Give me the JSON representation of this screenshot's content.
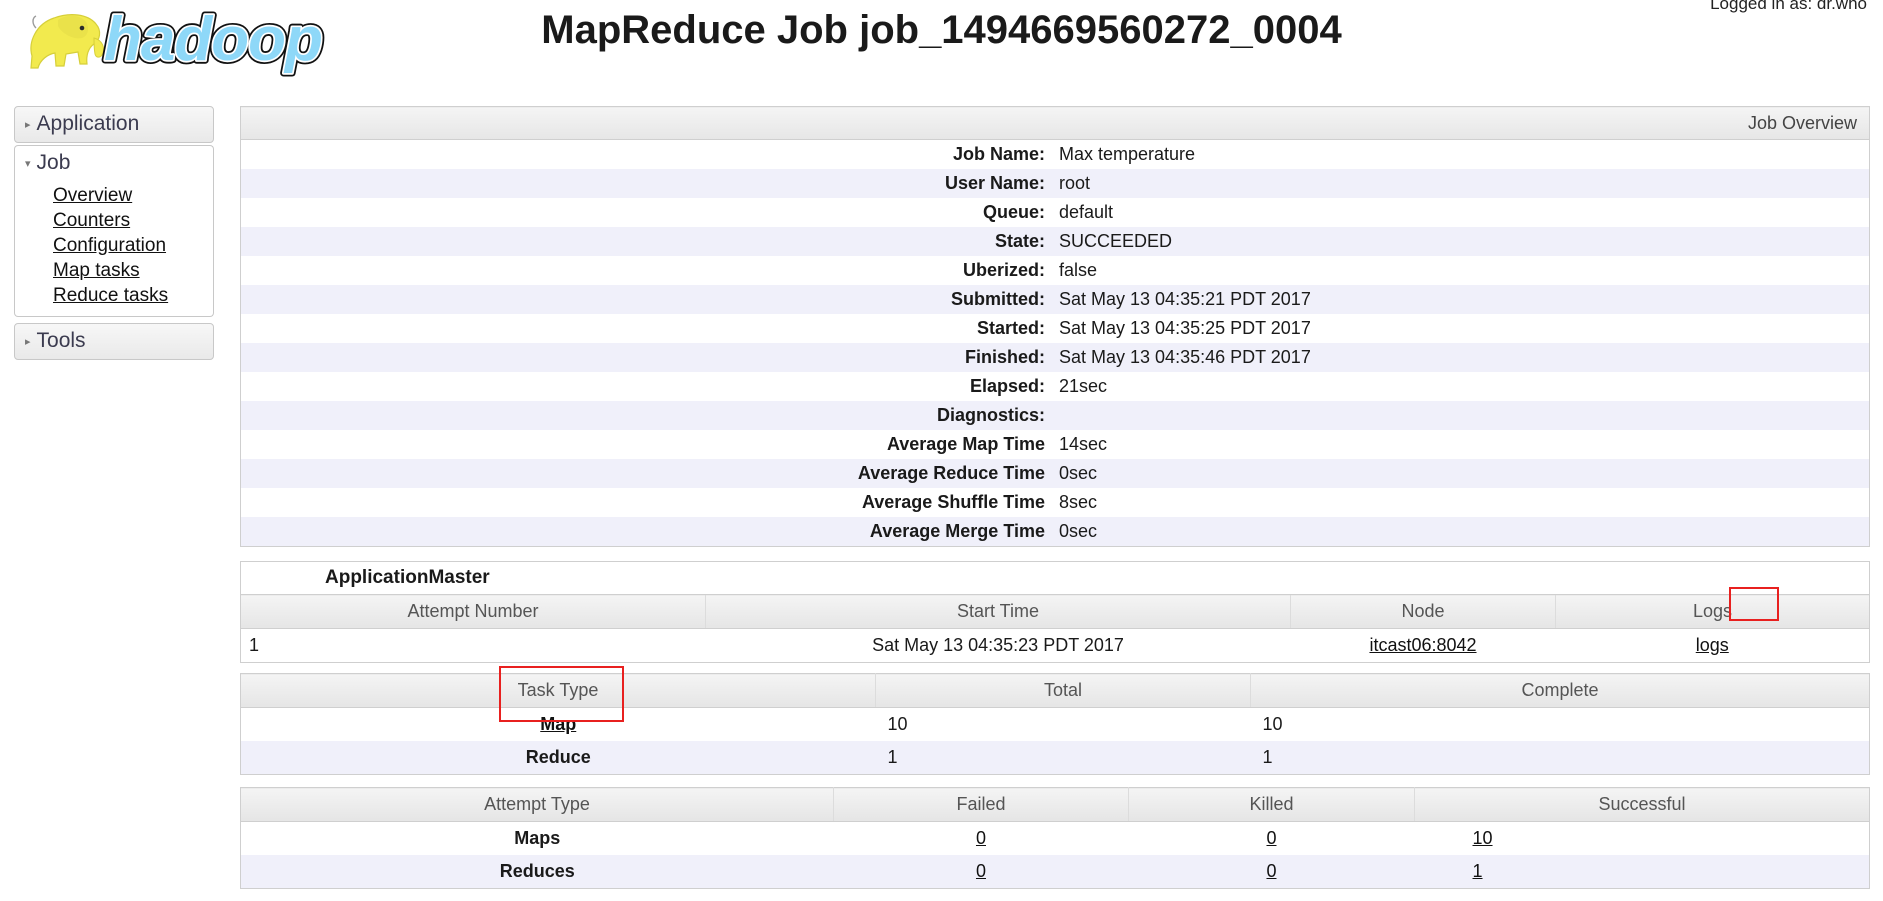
{
  "header": {
    "title": "MapReduce Job job_1494669560272_0004",
    "logged_in": "Logged in as: dr.who",
    "logo_alt": "hadoop"
  },
  "sidebar": {
    "sections": [
      {
        "label": "Application",
        "expanded": false,
        "caret": "▸"
      },
      {
        "label": "Job",
        "expanded": true,
        "caret": "▾"
      },
      {
        "label": "Tools",
        "expanded": false,
        "caret": "▸"
      }
    ],
    "job_items": [
      {
        "label": "Overview"
      },
      {
        "label": "Counters"
      },
      {
        "label": "Configuration"
      },
      {
        "label": "Map tasks"
      },
      {
        "label": "Reduce tasks"
      }
    ]
  },
  "overview": {
    "caption": "Job Overview",
    "rows": [
      {
        "key": "Job Name:",
        "value": "Max temperature"
      },
      {
        "key": "User Name:",
        "value": "root"
      },
      {
        "key": "Queue:",
        "value": "default"
      },
      {
        "key": "State:",
        "value": "SUCCEEDED"
      },
      {
        "key": "Uberized:",
        "value": "false"
      },
      {
        "key": "Submitted:",
        "value": "Sat May 13 04:35:21 PDT 2017"
      },
      {
        "key": "Started:",
        "value": "Sat May 13 04:35:25 PDT 2017"
      },
      {
        "key": "Finished:",
        "value": "Sat May 13 04:35:46 PDT 2017"
      },
      {
        "key": "Elapsed:",
        "value": "21sec"
      },
      {
        "key": "Diagnostics:",
        "value": ""
      },
      {
        "key": "Average Map Time",
        "value": "14sec"
      },
      {
        "key": "Average Reduce Time",
        "value": "0sec"
      },
      {
        "key": "Average Shuffle Time",
        "value": "8sec"
      },
      {
        "key": "Average Merge Time",
        "value": "0sec"
      }
    ]
  },
  "application_master": {
    "caption": "ApplicationMaster",
    "columns": [
      "Attempt Number",
      "Start Time",
      "Node",
      "Logs"
    ],
    "rows": [
      {
        "attempt_number": "1",
        "start_time": "Sat May 13 04:35:23 PDT 2017",
        "node": "itcast06:8042",
        "logs": "logs"
      }
    ]
  },
  "tasks": {
    "columns": [
      "Task Type",
      "Total",
      "Complete"
    ],
    "rows": [
      {
        "type": "Map",
        "total": "10",
        "complete": "10",
        "is_link": true
      },
      {
        "type": "Reduce",
        "total": "1",
        "complete": "1",
        "is_link": false
      }
    ]
  },
  "attempts": {
    "columns": [
      "Attempt Type",
      "Failed",
      "Killed",
      "Successful"
    ],
    "rows": [
      {
        "type": "Maps",
        "failed": "0",
        "killed": "0",
        "successful": "10"
      },
      {
        "type": "Reduces",
        "failed": "0",
        "killed": "0",
        "successful": "1"
      }
    ]
  },
  "annotations": {
    "logs_box_color": "#e8201f",
    "task_type_box_color": "#e8201f"
  }
}
